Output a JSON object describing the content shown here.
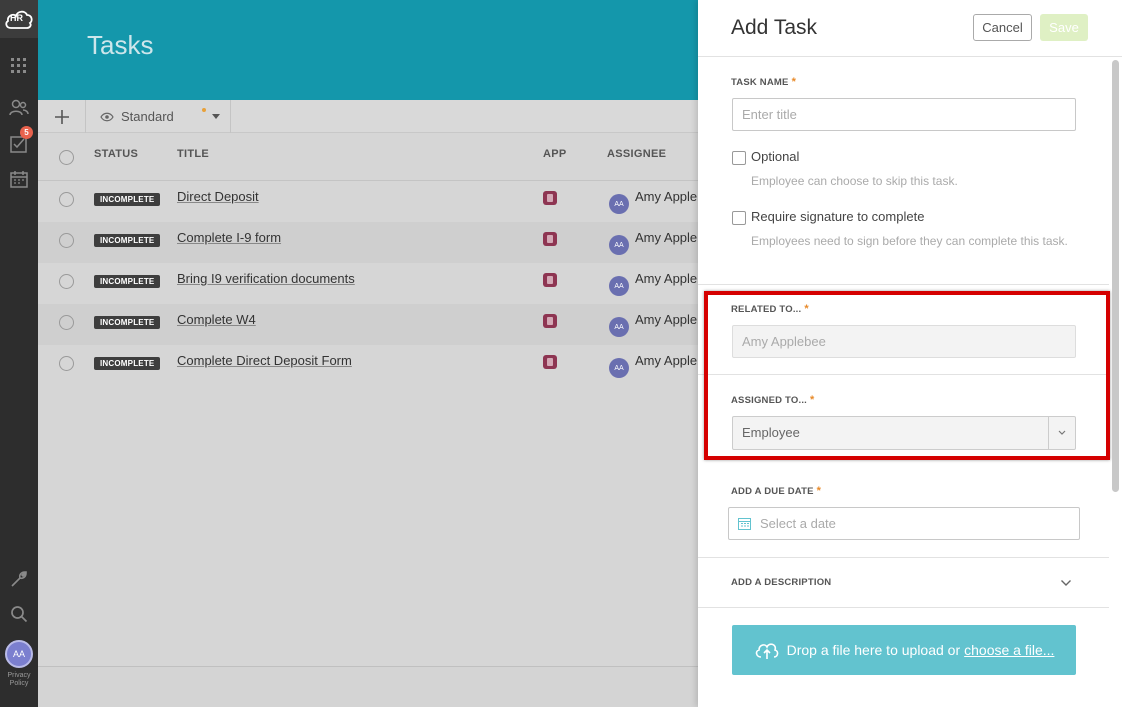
{
  "nav": {
    "logo": "HR",
    "badge_count": "5",
    "user_initials": "AA",
    "privacy": "Privacy Policy",
    "icons": [
      "apps-grid-icon",
      "people-icon",
      "tasks-icon",
      "calendar-icon",
      "wrench-icon",
      "search-icon"
    ]
  },
  "header": {
    "title": "Tasks"
  },
  "toolbar": {
    "view_label": "Standard"
  },
  "table": {
    "columns": [
      "STATUS",
      "TITLE",
      "APP",
      "ASSIGNEE"
    ],
    "rows": [
      {
        "status": "INCOMPLETE",
        "title": "Direct Deposit",
        "assignee_initials": "AA",
        "assignee": "Amy Applebee"
      },
      {
        "status": "INCOMPLETE",
        "title": "Complete I-9 form",
        "assignee_initials": "AA",
        "assignee": "Amy Applebee"
      },
      {
        "status": "INCOMPLETE",
        "title": "Bring I9 verification documents",
        "assignee_initials": "AA",
        "assignee": "Amy Applebee"
      },
      {
        "status": "INCOMPLETE",
        "title": "Complete W4",
        "assignee_initials": "AA",
        "assignee": "Amy Applebee"
      },
      {
        "status": "INCOMPLETE",
        "title": "Complete Direct Deposit Form",
        "assignee_initials": "AA",
        "assignee": "Amy Applebee"
      }
    ]
  },
  "panel": {
    "title": "Add Task",
    "cancel_label": "Cancel",
    "save_label": "Save",
    "task_name_label": "TASK NAME",
    "task_name_placeholder": "Enter title",
    "optional_label": "Optional",
    "optional_help": "Employee can choose to skip this task.",
    "signature_label": "Require signature to complete",
    "signature_help": "Employees need to sign before they can complete this task.",
    "related_label": "RELATED TO...",
    "related_value": "Amy Applebee",
    "assigned_label": "ASSIGNED TO...",
    "assigned_value": "Employee",
    "due_label": "ADD A DUE DATE",
    "due_placeholder": "Select a date",
    "description_label": "ADD A DESCRIPTION",
    "upload_text": "Drop a file here to upload or",
    "upload_link": "choose a file..."
  },
  "colors": {
    "header": "#1497ab",
    "status_badge": "#3e3e3e",
    "upload": "#62c3cf",
    "highlight": "#d50000",
    "required": "#e88a2a"
  }
}
